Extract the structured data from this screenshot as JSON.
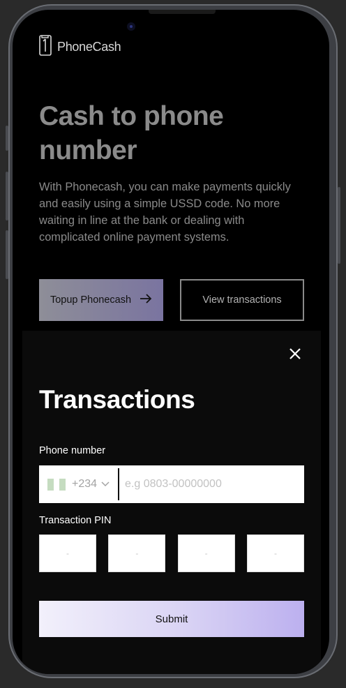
{
  "brand": {
    "name": "PhoneCash"
  },
  "hero": {
    "title": "Cash to phone number",
    "description": "With Phonecash, you can make payments quickly and easily using a simple USSD code. No more waiting in line at the bank or dealing with complicated online payment systems.",
    "topup_label": "Topup Phonecash",
    "view_label": "View transactions"
  },
  "modal": {
    "title": "Transactions",
    "phone_label": "Phone number",
    "country_code": "+234",
    "phone_placeholder": "e.g 0803-00000000",
    "pin_label": "Transaction PIN",
    "pins": [
      {
        "placeholder": "-"
      },
      {
        "placeholder": "-"
      },
      {
        "placeholder": "-"
      },
      {
        "placeholder": "-"
      }
    ],
    "submit_label": "Submit"
  },
  "icons": {
    "logo": "phone-logo-icon",
    "arrow": "arrow-right-icon",
    "close": "close-icon",
    "flag": "nigeria-flag-icon",
    "chevron": "chevron-down-icon"
  },
  "colors": {
    "accent_start": "#8e8e98",
    "accent_end": "#7a74a0",
    "submit_start": "#f2f0fb",
    "submit_end": "#bcb0ef",
    "flag_green": "#c5dcc0"
  }
}
